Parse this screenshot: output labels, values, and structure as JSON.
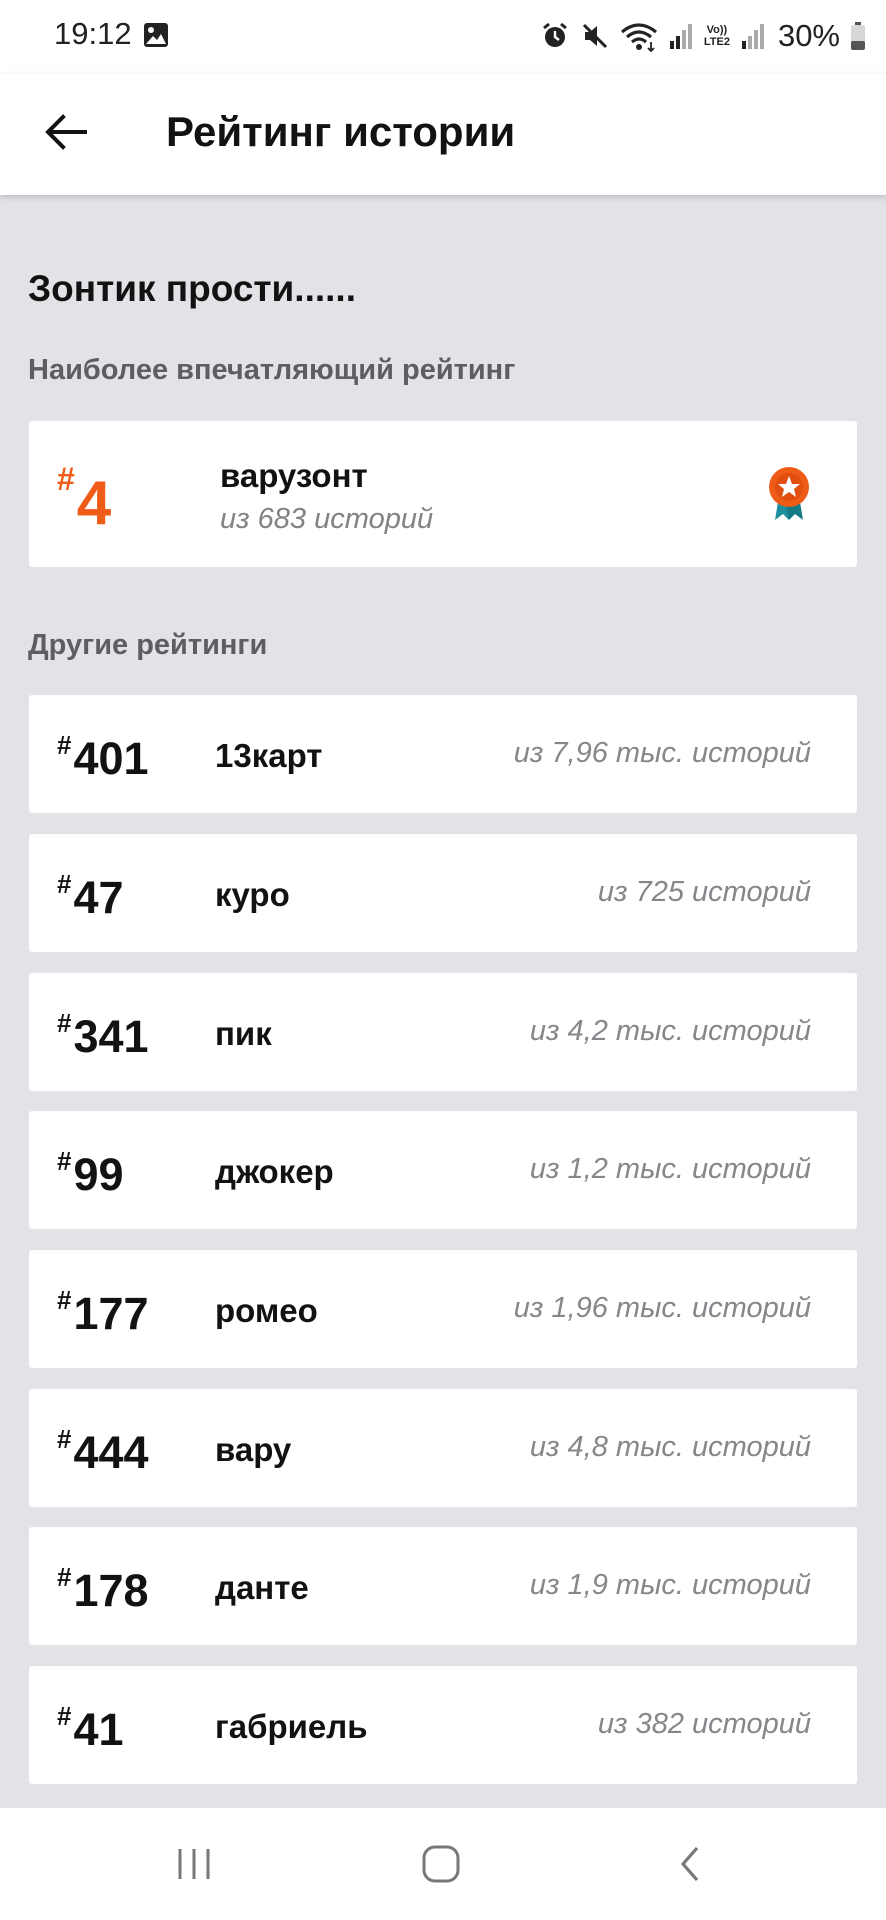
{
  "status_bar": {
    "time": "19:12",
    "volte_line1": "Vo))",
    "volte_line2": "LTE2",
    "battery": "30%"
  },
  "app_bar": {
    "title": "Рейтинг истории",
    "back_icon": "arrow-left-icon"
  },
  "story": {
    "title": "Зонтик прости......"
  },
  "highlight_section": {
    "label": "Наиболее впечатляющий рейтинг",
    "rank_hash": "#",
    "rank": "4",
    "tag": "варузонт",
    "count": "из 683 историй",
    "badge_icon": "medal-star-icon",
    "accent_color": "#ef5c17"
  },
  "other_section": {
    "label": "Другие рейтинги",
    "rows": [
      {
        "hash": "#",
        "rank": "401",
        "tag": "13карт",
        "count": "из 7,96 тыс. историй"
      },
      {
        "hash": "#",
        "rank": "47",
        "tag": "куро",
        "count": "из 725 историй"
      },
      {
        "hash": "#",
        "rank": "341",
        "tag": "пик",
        "count": "из 4,2 тыс. историй"
      },
      {
        "hash": "#",
        "rank": "99",
        "tag": "джокер",
        "count": "из 1,2 тыс. историй"
      },
      {
        "hash": "#",
        "rank": "177",
        "tag": "ромео",
        "count": "из 1,96 тыс. историй"
      },
      {
        "hash": "#",
        "rank": "444",
        "tag": "вару",
        "count": "из 4,8 тыс. историй"
      },
      {
        "hash": "#",
        "rank": "178",
        "tag": "данте",
        "count": "из 1,9 тыс. историй"
      },
      {
        "hash": "#",
        "rank": "41",
        "tag": "габриель",
        "count": "из 382 историй"
      }
    ]
  },
  "nav_bar": {
    "recents_icon": "recents-icon",
    "home_icon": "home-icon",
    "back_icon": "back-chevron-icon"
  }
}
